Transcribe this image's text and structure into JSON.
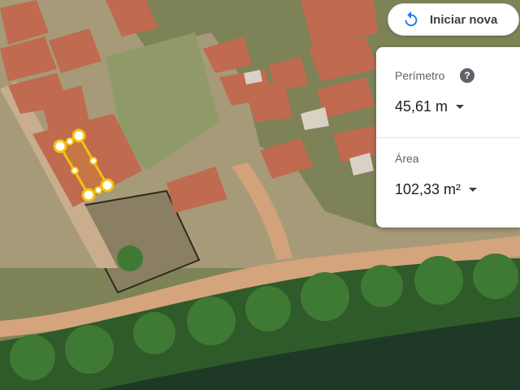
{
  "restart": {
    "label": "Iniciar nova",
    "icon": "restart-icon"
  },
  "measure": {
    "perimeter": {
      "label": "Perímetro",
      "value": "45,61 m"
    },
    "area": {
      "label": "Área",
      "value": "102,33 m²"
    },
    "help_icon_glyph": "?"
  },
  "colors": {
    "accent": "#1a73e8",
    "measure_line": "#f4c20d"
  }
}
